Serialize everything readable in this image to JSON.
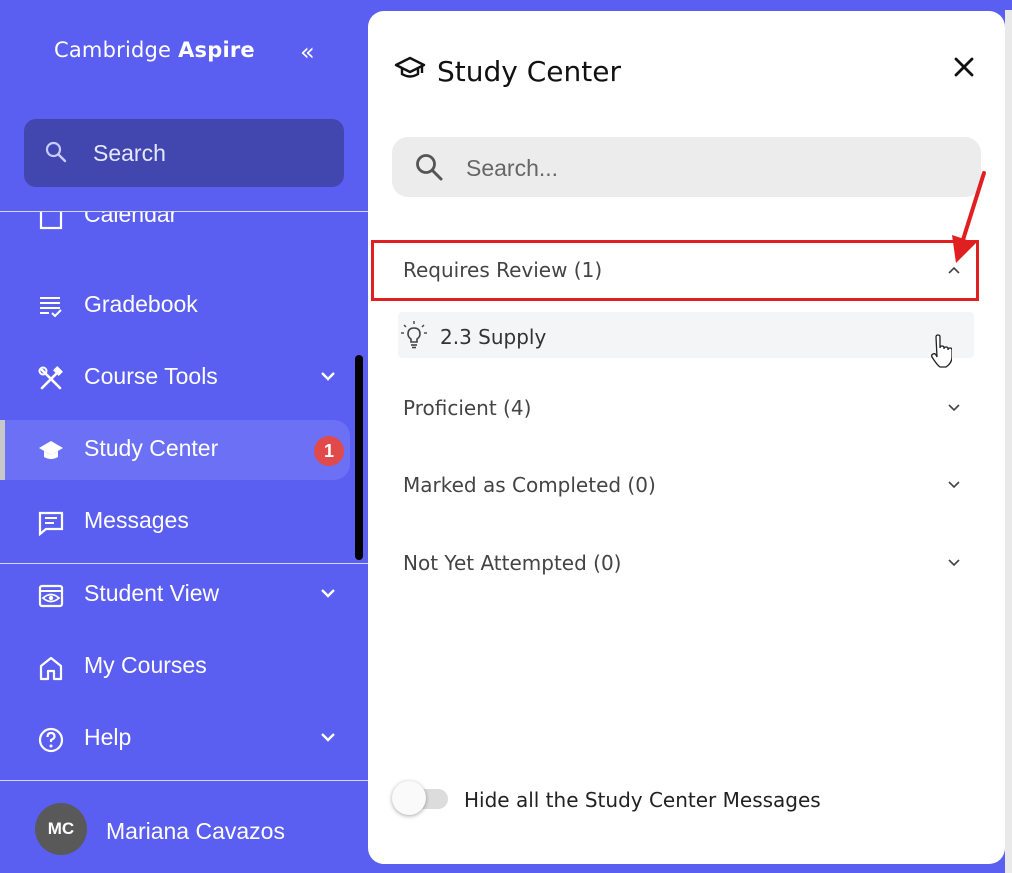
{
  "sidebar": {
    "brand_light": "Cambridge",
    "brand_bold": "Aspire",
    "collapse_glyph": "«",
    "search_label": "Search",
    "items": [
      {
        "label": "Calendar",
        "icon": "calendar-icon"
      },
      {
        "label": "Gradebook",
        "icon": "gradebook-icon"
      },
      {
        "label": "Course Tools",
        "icon": "tools-icon",
        "expandable": true
      },
      {
        "label": "Study Center",
        "icon": "graduation-cap-icon",
        "badge": "1",
        "active": true
      },
      {
        "label": "Messages",
        "icon": "message-icon"
      },
      {
        "label": "Student View",
        "icon": "eye-icon",
        "expandable": true
      },
      {
        "label": "My Courses",
        "icon": "home-icon"
      },
      {
        "label": "Help",
        "icon": "help-icon",
        "expandable": true
      }
    ],
    "user": {
      "initials": "MC",
      "name": "Mariana Cavazos"
    }
  },
  "panel": {
    "title": "Study Center",
    "search_placeholder": "Search...",
    "sections": [
      {
        "label": "Requires Review (1)",
        "expanded": true
      },
      {
        "label": "Proficient (4)",
        "expanded": false
      },
      {
        "label": "Marked as Completed (0)",
        "expanded": false
      },
      {
        "label": "Not Yet Attempted (0)",
        "expanded": false
      }
    ],
    "requires_review_items": [
      {
        "label": "2.3 Supply",
        "icon": "lightbulb-icon"
      }
    ],
    "toggle_label": "Hide all the Study Center Messages",
    "toggle_on": false
  },
  "colors": {
    "sidebar_bg": "#5a5ff2",
    "sidebar_search_bg": "#4247b0",
    "badge": "#e04a4a",
    "highlight": "#e02020"
  }
}
